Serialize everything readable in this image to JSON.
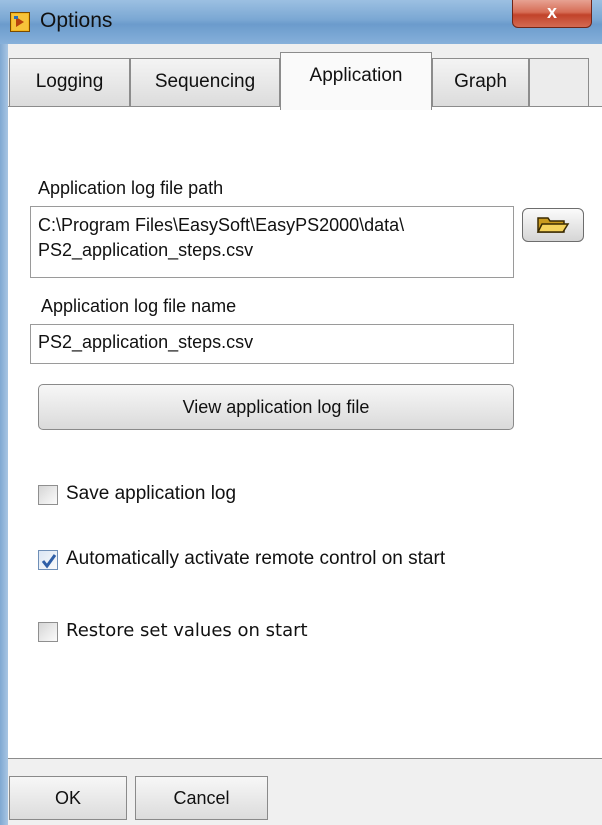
{
  "window": {
    "title": "Options",
    "close_glyph": "x",
    "icon": "app-icon"
  },
  "tabs": [
    {
      "label": "Logging",
      "active": false
    },
    {
      "label": "Sequencing",
      "active": false
    },
    {
      "label": "Application",
      "active": true
    },
    {
      "label": "Graph",
      "active": false
    }
  ],
  "application": {
    "path_label": "Application log file path",
    "path_value_line1": "C:\\Program Files\\EasySoft\\EasyPS2000\\data\\",
    "path_value_line2": "PS2_application_steps.csv",
    "browse_icon": "folder-open-icon",
    "name_label": "Application log file name",
    "name_value": "PS2_application_steps.csv",
    "view_button": "View application log file"
  },
  "options": {
    "save_log": {
      "label": "Save application log",
      "checked": false
    },
    "auto_remote": {
      "label": "Automatically activate remote control on start",
      "checked": true
    },
    "restore_values": {
      "label": "Restore set values on start",
      "checked": false
    }
  },
  "footer": {
    "ok": "OK",
    "cancel": "Cancel"
  },
  "colors": {
    "titlebar": "#7aa7d3",
    "close": "#c1432a",
    "check_accent": "#2f5fa7"
  }
}
